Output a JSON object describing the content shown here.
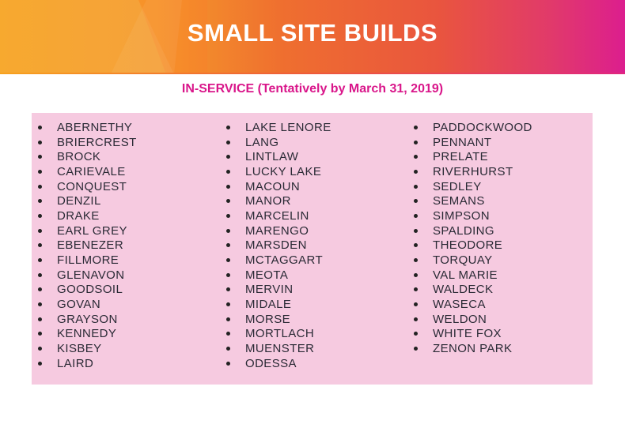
{
  "header": {
    "title": "SMALL SITE BUILDS",
    "colors": {
      "gradient_start": "#f7a21e",
      "gradient_end": "#dc1e8e"
    }
  },
  "subtitle": "IN-SERVICE (Tentatively by March 31, 2019)",
  "accent_color": "#d9168a",
  "panel_color": "#f6cae0",
  "columns": [
    [
      "ABERNETHY",
      "BRIERCREST",
      "BROCK",
      "CARIEVALE",
      "CONQUEST",
      "DENZIL",
      "DRAKE",
      "EARL GREY",
      "EBENEZER",
      "FILLMORE",
      "GLENAVON",
      "GOODSOIL",
      "GOVAN",
      "GRAYSON",
      "KENNEDY",
      "KISBEY",
      "LAIRD"
    ],
    [
      "LAKE LENORE",
      "LANG",
      "LINTLAW",
      "LUCKY LAKE",
      "MACOUN",
      "MANOR",
      "MARCELIN",
      "MARENGO",
      "MARSDEN",
      "MCTAGGART",
      "MEOTA",
      "MERVIN",
      "MIDALE",
      "MORSE",
      "MORTLACH",
      "MUENSTER",
      "ODESSA"
    ],
    [
      "PADDOCKWOOD",
      "PENNANT",
      "PRELATE",
      "RIVERHURST",
      "SEDLEY",
      "SEMANS",
      "SIMPSON",
      "SPALDING",
      "THEODORE",
      "TORQUAY",
      "VAL MARIE",
      "WALDECK",
      "WASECA",
      "WELDON",
      "WHITE FOX",
      "ZENON PARK"
    ]
  ]
}
